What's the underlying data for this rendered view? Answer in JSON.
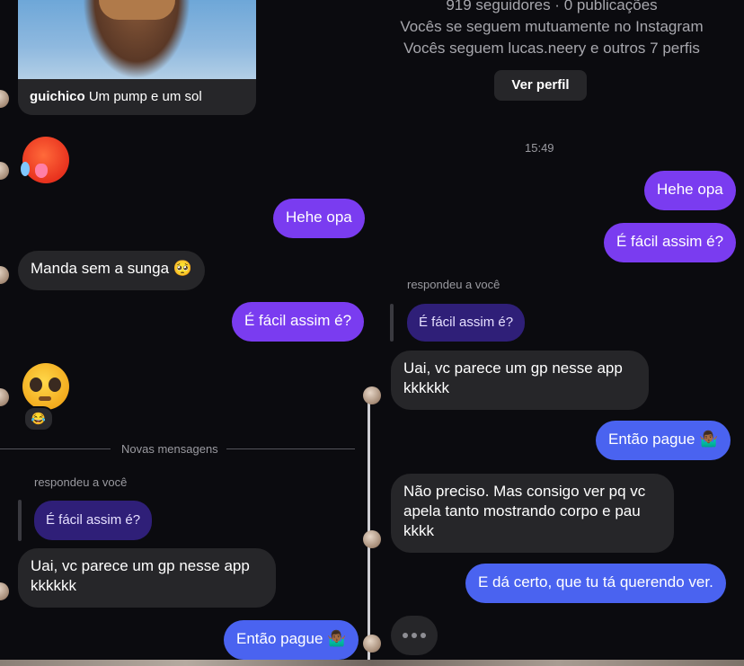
{
  "left": {
    "post": {
      "author": "guichico",
      "caption": "Um pump e um sol"
    },
    "messages": {
      "hehe": "Hehe opa",
      "manda": "Manda sem a sunga 🥺",
      "facil": "É fácil assim é?",
      "divider": "Novas mensagens",
      "replied": "respondeu a você",
      "quoted": "É fácil assim é?",
      "uai": "Uai, vc parece um gp nesse app kkkkkk",
      "entao": "Então pague 🤷🏾‍♂️",
      "reaction": "😂"
    }
  },
  "right": {
    "profile": {
      "counts": "919 seguidores · 0 publicações",
      "mutual": "Vocês se seguem mutuamente no Instagram",
      "follow": "Vocês seguem lucas.neery e outros 7 perfis",
      "button": "Ver perfil"
    },
    "time": "15:49",
    "messages": {
      "hehe": "Hehe opa",
      "facil": "É fácil assim é?",
      "replied": "respondeu a você",
      "quoted": "É fácil assim é?",
      "uai": "Uai, vc parece um gp nesse app kkkkkk",
      "entao": "Então pague 🤷🏾‍♂️",
      "nao": "Não preciso. Mas consigo ver pq vc apela tanto mostrando corpo e pau kkkk",
      "da_certo": "E dá certo, que tu tá querendo ver."
    }
  },
  "colors": {
    "purple": "#7a3cf0",
    "blue": "#4a63f0",
    "incoming": "#262629",
    "background": "#0b0b0f"
  }
}
